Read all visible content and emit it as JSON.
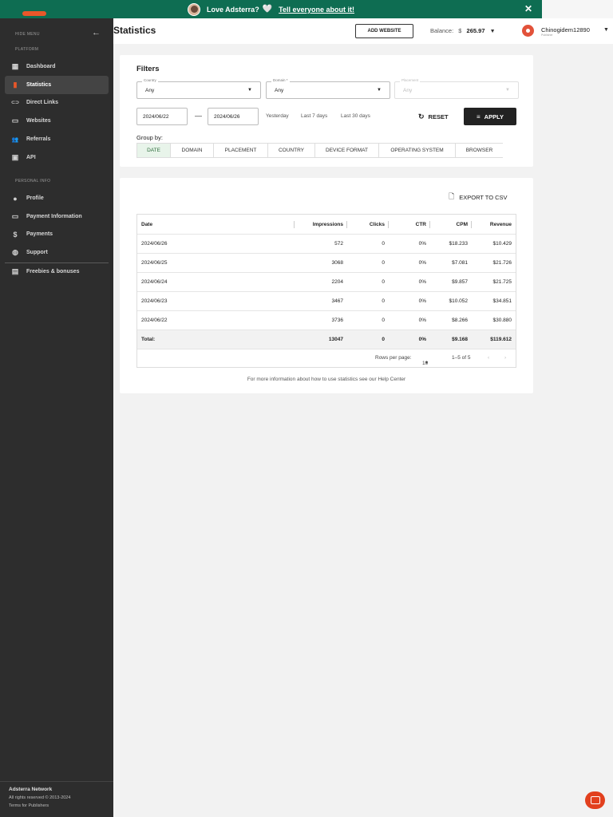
{
  "banner": {
    "text": "Love Adsterra?",
    "heart": "🤍",
    "link": "Tell everyone about it!",
    "close": "✕"
  },
  "sidebar": {
    "hide_menu": "HIDE MENU",
    "hide_arrow": "←",
    "platform_label": "PLATFORM",
    "platform_items": [
      {
        "label": "Dashboard",
        "icon": "dashboard-icon",
        "glyph": "▦"
      },
      {
        "label": "Statistics",
        "icon": "bar-chart-icon",
        "glyph": "▮"
      },
      {
        "label": "Direct Links",
        "icon": "link-icon",
        "glyph": "⊂⊃"
      },
      {
        "label": "Websites",
        "icon": "monitor-icon",
        "glyph": "▭"
      },
      {
        "label": "Referrals",
        "icon": "people-icon",
        "glyph": "👥"
      },
      {
        "label": "API",
        "icon": "terminal-icon",
        "glyph": "▣"
      }
    ],
    "personal_label": "PERSONAL INFO",
    "personal_items": [
      {
        "label": "Profile",
        "icon": "account-icon",
        "glyph": "●"
      },
      {
        "label": "Payment Information",
        "icon": "credit-card-icon",
        "glyph": "▭"
      },
      {
        "label": "Payments",
        "icon": "dollar-icon",
        "glyph": "$"
      },
      {
        "label": "Support",
        "icon": "support-icon",
        "glyph": "◍"
      },
      {
        "label": "Freebies & bonuses",
        "icon": "gift-icon",
        "glyph": "▤"
      }
    ],
    "footer": {
      "company": "Adsterra Network",
      "rights": "All rights reserved © 2013-2024",
      "terms": "Terms for Publishers"
    }
  },
  "header": {
    "title": "Statistics",
    "add_website": "ADD WEBSITE",
    "balance_label": "Balance:",
    "balance_currency": "$",
    "balance_value": "265.97",
    "username": "Chinogidem12890",
    "role": "Publisher"
  },
  "filters": {
    "title": "Filters",
    "country": {
      "label": "Country",
      "value": "Any"
    },
    "domain": {
      "label": "Domain *",
      "value": "Any"
    },
    "placement": {
      "label": "Placement",
      "value": "Any"
    },
    "date_from": "2024/06/22",
    "date_to": "2024/06/26",
    "dash": "—",
    "quick_ranges": [
      "Yesterday",
      "Last 7 days",
      "Last 30 days"
    ],
    "reset": "RESET",
    "apply": "APPLY",
    "group_by_label": "Group by:",
    "group_by_tabs": [
      "DATE",
      "DOMAIN",
      "PLACEMENT",
      "COUNTRY",
      "DEVICE FORMAT",
      "OPERATING SYSTEM",
      "BROWSER"
    ]
  },
  "report": {
    "export": "EXPORT TO CSV",
    "columns": [
      "Date",
      "Impressions",
      "Clicks",
      "CTR",
      "CPM",
      "Revenue"
    ],
    "rows": [
      [
        "2024/06/26",
        "572",
        "0",
        "0%",
        "$18.233",
        "$10.429"
      ],
      [
        "2024/06/25",
        "3068",
        "0",
        "0%",
        "$7.081",
        "$21.726"
      ],
      [
        "2024/06/24",
        "2204",
        "0",
        "0%",
        "$9.857",
        "$21.725"
      ],
      [
        "2024/06/23",
        "3467",
        "0",
        "0%",
        "$10.052",
        "$34.851"
      ],
      [
        "2024/06/22",
        "3736",
        "0",
        "0%",
        "$8.266",
        "$30.880"
      ]
    ],
    "total": [
      "Total:",
      "13047",
      "0",
      "0%",
      "$9.168",
      "$119.612"
    ],
    "rows_per_page_label": "Rows per page:",
    "rows_per_page": "10",
    "page_range": "1–5 of 5",
    "help_text": "For more information about how to use statistics see our Help Center"
  },
  "colors": {
    "banner": "#0e6d52",
    "sidebar": "#2d2d2d",
    "accent": "#e8572a",
    "active_tab": "#e8f4ea"
  }
}
